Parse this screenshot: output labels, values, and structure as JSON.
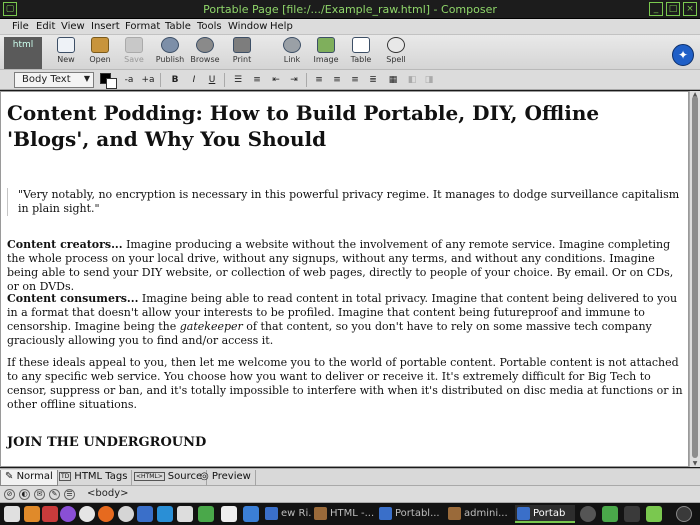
{
  "window": {
    "title": "Portable Page [file:/.../Example_raw.html] - Composer"
  },
  "menubar": [
    "File",
    "Edit",
    "View",
    "Insert",
    "Format",
    "Table",
    "Tools",
    "Window",
    "Help"
  ],
  "toolbar": {
    "logo_text": "html",
    "buttons": [
      {
        "label": "New",
        "icon": "new-page-icon"
      },
      {
        "label": "Open",
        "icon": "folder-icon"
      },
      {
        "label": "Save",
        "icon": "save-icon",
        "disabled": true
      },
      {
        "label": "Publish",
        "icon": "globe-icon"
      },
      {
        "label": "Browse",
        "icon": "gear-icon"
      },
      {
        "label": "Print",
        "icon": "printer-icon"
      },
      {
        "label": "Link",
        "icon": "chain-link-icon"
      },
      {
        "label": "Image",
        "icon": "image-icon"
      },
      {
        "label": "Table",
        "icon": "table-icon"
      },
      {
        "label": "Spell",
        "icon": "spell-check-icon"
      }
    ]
  },
  "format": {
    "paragraph_style": "Body Text",
    "bold": "B",
    "italic": "I",
    "underline": "U"
  },
  "document": {
    "heading": "Content Podding: How to Build Portable, DIY, Offline 'Blogs', and Why You Should",
    "quote": "\"Very notably, no encryption is necessary in this powerful privacy regime. It manages to dodge surveillance capitalism in plain sight.\"",
    "creators_lead": "Content creators...",
    "creators_text": " Imagine producing a website without the involvement of any remote service. Imagine completing the whole process on your local drive, without any signups, without any terms, and without any conditions. Imagine being able to send your DIY website, or collection of web pages, directly to people of your choice. By email. Or on CDs, or on DVDs.",
    "consumers_lead": "Content consumers...",
    "consumers_text_1": " Imagine being able to read content in total privacy. Imagine that content being delivered to you in a format that doesn't allow your interests to be profiled. Imagine that content being futureproof and immune to censorship. Imagine being the ",
    "consumers_em": "gatekeeper",
    "consumers_text_2": " of that content, so you don't have to rely on some massive tech company graciously allowing you to find and/or access it.",
    "ideals_text": "If these ideals appeal to you, then let me welcome you to the world of portable content. Portable content is not attached to any specific web service. You choose how you want to deliver or receive it. It's extremely difficult for Big Tech to censor, suppress or ban, and it's totally impossible to interfere with when it's distributed on disc media at functions or in other offline situations.",
    "subheading": "JOIN THE UNDERGROUND"
  },
  "modes": [
    {
      "label": "Normal",
      "active": true
    },
    {
      "label": "HTML Tags",
      "active": false
    },
    {
      "label": "Source",
      "active": false
    },
    {
      "label": "Preview",
      "active": false
    }
  ],
  "mode_mini_labels": {
    "tags": "TD",
    "source": "<HTML>"
  },
  "status": {
    "tag_path": "<body>"
  },
  "taskbar": {
    "windows": [
      {
        "label": "ew Ri...",
        "active": false
      },
      {
        "label": "HTML -...",
        "active": false
      },
      {
        "label": "Portabl...",
        "active": false
      },
      {
        "label": "admini...",
        "active": false
      },
      {
        "label": "Portab",
        "active": true
      }
    ]
  },
  "colors": {
    "title_text": "#8fd66a",
    "accent": "#7ac84f",
    "taskbar_bg": "#131313"
  }
}
